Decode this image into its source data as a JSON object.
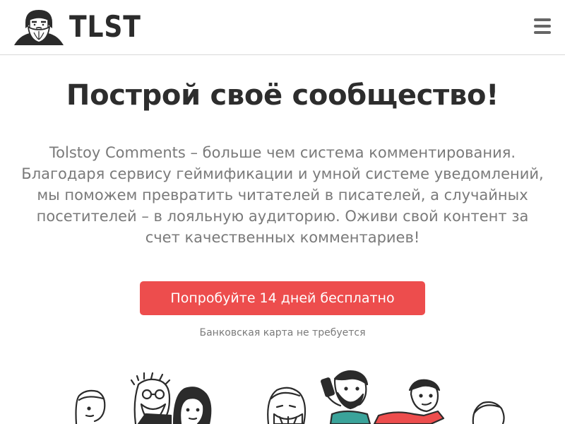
{
  "header": {
    "logo_text": "TLST",
    "logo_icon": "tolstoy-portrait-icon",
    "menu_icon": "hamburger-menu-icon"
  },
  "hero": {
    "title": "Построй своё сообщество!",
    "description": "Tolstoy Comments – больше чем система комментирования. Благодаря сервису геймификации и умной системе уведомлений, мы поможем превратить читателей в писателей, а случайных посетителей – в лояльную аудиторию. Оживи свой контент за счет качественных комментариев!",
    "cta_label": "Попробуйте 14 дней бесплатно",
    "cta_note": "Банковская карта не требуется"
  },
  "colors": {
    "accent": "#ed4d4d",
    "text_dark": "#2d2d2d",
    "text_muted": "#7a7a7a"
  },
  "illustration": {
    "icon": "people-with-devices-illustration"
  }
}
